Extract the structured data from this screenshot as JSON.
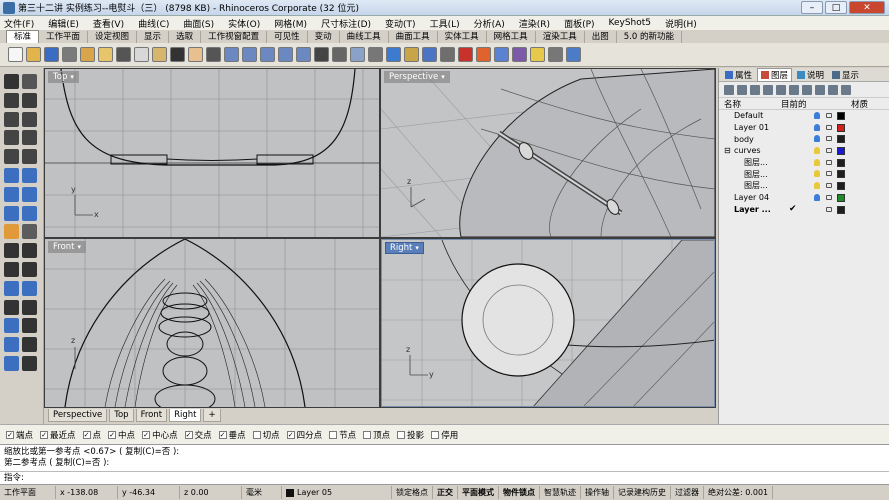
{
  "app": {
    "title": "第三十二讲 实例练习--电熨斗（三） (8798 KB) - Rhinoceros Corporate (32 位元)",
    "min": "–",
    "max": "□",
    "close": "✕"
  },
  "menu": [
    "文件(F)",
    "编辑(E)",
    "查看(V)",
    "曲线(C)",
    "曲面(S)",
    "实体(O)",
    "网格(M)",
    "尺寸标注(D)",
    "变动(T)",
    "工具(L)",
    "分析(A)",
    "渲染(R)",
    "面板(P)",
    "KeyShot5",
    "说明(H)"
  ],
  "tabs": [
    "标准",
    "工作平面",
    "设定视图",
    "显示",
    "选取",
    "工作视窗配置",
    "可见性",
    "变动",
    "曲线工具",
    "曲面工具",
    "实体工具",
    "网格工具",
    "渲染工具",
    "出图",
    "5.0 的新功能"
  ],
  "toolbar_icons": [
    {
      "name": "new-file-icon",
      "color": "#f6f6f6"
    },
    {
      "name": "open-icon",
      "color": "#e3b44c"
    },
    {
      "name": "save-icon",
      "color": "#3a6cc4"
    },
    {
      "name": "print-icon",
      "color": "#7a7a7a"
    },
    {
      "name": "import-icon",
      "color": "#d9a54a"
    },
    {
      "name": "export-icon",
      "color": "#e7c56a"
    },
    {
      "name": "cut-icon",
      "color": "#555555"
    },
    {
      "name": "copy-icon",
      "color": "#d8d8d8"
    },
    {
      "name": "paste-icon",
      "color": "#d6b66c"
    },
    {
      "name": "undo-icon",
      "color": "#333333"
    },
    {
      "name": "pan-icon",
      "color": "#e8c090"
    },
    {
      "name": "rotate-view-icon",
      "color": "#555555"
    },
    {
      "name": "zoom-icon",
      "color": "#6b88c0"
    },
    {
      "name": "zoom-window-icon",
      "color": "#6b88c0"
    },
    {
      "name": "zoom-extents-icon",
      "color": "#6b88c0"
    },
    {
      "name": "zoom-selected-icon",
      "color": "#6b88c0"
    },
    {
      "name": "zoom-all-icon",
      "color": "#6b88c0"
    },
    {
      "name": "move-icon",
      "color": "#444444"
    },
    {
      "name": "select-icon",
      "color": "#666666"
    },
    {
      "name": "cplane-icon",
      "color": "#8aa2c8"
    },
    {
      "name": "grid-icon",
      "color": "#777777"
    },
    {
      "name": "hide-icon",
      "color": "#3d7bd0"
    },
    {
      "name": "lock-icon",
      "color": "#c9a54a"
    },
    {
      "name": "layer-icon",
      "color": "#4c74c4"
    },
    {
      "name": "properties-icon",
      "color": "#6e6e6e"
    },
    {
      "name": "render-icon",
      "color": "#c8322a"
    },
    {
      "name": "color-wheel-icon",
      "color": "#e0622c"
    },
    {
      "name": "shaded-icon",
      "color": "#5a82d0"
    },
    {
      "name": "rendered-icon",
      "color": "#7d5aa8"
    },
    {
      "name": "light-icon",
      "color": "#e6c84a"
    },
    {
      "name": "options-icon",
      "color": "#777777"
    },
    {
      "name": "help-icon",
      "color": "#4b7cc8"
    }
  ],
  "left_tools": [
    {
      "name": "select-arrow-icon",
      "color": "#333333"
    },
    {
      "name": "point-icon",
      "color": "#555555"
    },
    {
      "name": "polyline-icon",
      "color": "#3c3c3c"
    },
    {
      "name": "curve-icon",
      "color": "#3c3c3c"
    },
    {
      "name": "circle-icon",
      "color": "#444444"
    },
    {
      "name": "arc-icon",
      "color": "#444444"
    },
    {
      "name": "rectangle-icon",
      "color": "#444444"
    },
    {
      "name": "polygon-icon",
      "color": "#444444"
    },
    {
      "name": "ellipse-icon",
      "color": "#444444"
    },
    {
      "name": "fillet-curve-icon",
      "color": "#444444"
    },
    {
      "name": "surface-corner-icon",
      "color": "#3c6fbf"
    },
    {
      "name": "extrude-surface-icon",
      "color": "#3c6fbf"
    },
    {
      "name": "box-solid-icon",
      "color": "#3c6fbf"
    },
    {
      "name": "extrude-solid-icon",
      "color": "#3c6fbf"
    },
    {
      "name": "sphere-icon",
      "color": "#3c6fbf"
    },
    {
      "name": "mesh-icon",
      "color": "#3c6fbf"
    },
    {
      "name": "boolean-icon",
      "color": "#e09a3a"
    },
    {
      "name": "union-icon",
      "color": "#5c5c5c"
    },
    {
      "name": "trim-icon",
      "color": "#333333"
    },
    {
      "name": "split-icon",
      "color": "#333333"
    },
    {
      "name": "join-icon",
      "color": "#333333"
    },
    {
      "name": "explode-icon",
      "color": "#333333"
    },
    {
      "name": "move-tool-icon",
      "color": "#3c6fbf"
    },
    {
      "name": "rotate-tool-icon",
      "color": "#3c6fbf"
    },
    {
      "name": "scale-icon",
      "color": "#333333"
    },
    {
      "name": "mirror-icon",
      "color": "#333333"
    },
    {
      "name": "array-icon",
      "color": "#3c6fbf"
    },
    {
      "name": "group-icon",
      "color": "#333333"
    },
    {
      "name": "dimension-icon",
      "color": "#3c6fbf"
    },
    {
      "name": "text-icon",
      "color": "#333333"
    },
    {
      "name": "analysis-icon",
      "color": "#3c6fbf"
    },
    {
      "name": "render-tool-icon",
      "color": "#333333"
    }
  ],
  "viewports": {
    "top": "Top",
    "perspective": "Perspective",
    "front": "Front",
    "right": "Right",
    "axis_x": "x",
    "axis_y": "y",
    "axis_z": "z"
  },
  "viewport_tabs": [
    "Perspective",
    "Top",
    "Front",
    "Right",
    "+"
  ],
  "panel": {
    "tabs": [
      "属性",
      "图层",
      "说明",
      "显示"
    ],
    "columns": [
      "名称",
      "目前的",
      "材质"
    ],
    "layers": [
      {
        "name": "Default",
        "indent": 0,
        "color": "#000000",
        "bulb": "#3b7dd8",
        "current": ""
      },
      {
        "name": "Layer 01",
        "indent": 0,
        "color": "#d21f1f",
        "bulb": "#3b7dd8",
        "current": ""
      },
      {
        "name": "body",
        "indent": 0,
        "color": "#1e1e1e",
        "bulb": "#3b7dd8",
        "current": ""
      },
      {
        "name": "curves",
        "indent": 0,
        "color": "#1a1ad1",
        "bulb": "#e8c93a",
        "current": "",
        "expand": "⊟"
      },
      {
        "name": "图层...",
        "indent": 1,
        "color": "#1e1e1e",
        "bulb": "#e8c93a",
        "current": ""
      },
      {
        "name": "图层...",
        "indent": 1,
        "color": "#1e1e1e",
        "bulb": "#e8c93a",
        "current": ""
      },
      {
        "name": "图层...",
        "indent": 1,
        "color": "#1e1e1e",
        "bulb": "#e8c93a",
        "current": ""
      },
      {
        "name": "Layer 04",
        "indent": 0,
        "color": "#1f8c2a",
        "bulb": "#3b7dd8",
        "current": ""
      },
      {
        "name": "Layer ...",
        "indent": 0,
        "color": "#1e1e1e",
        "bulb": "",
        "current": "✔",
        "bold": true
      }
    ]
  },
  "osnaps": [
    {
      "label": "端点",
      "checked": true
    },
    {
      "label": "最近点",
      "checked": true
    },
    {
      "label": "点",
      "checked": true
    },
    {
      "label": "中点",
      "checked": true
    },
    {
      "label": "中心点",
      "checked": true
    },
    {
      "label": "交点",
      "checked": true
    },
    {
      "label": "垂点",
      "checked": true
    },
    {
      "label": "切点",
      "checked": false
    },
    {
      "label": "四分点",
      "checked": true
    },
    {
      "label": "节点",
      "checked": false
    },
    {
      "label": "顶点",
      "checked": false
    },
    {
      "label": "投影",
      "checked": false
    },
    {
      "label": "停用",
      "checked": false
    }
  ],
  "command": {
    "history": [
      "缩放比或第一参考点 <0.67> ( 复制(C)=否 ):",
      "第二参考点 ( 复制(C)=否 ):"
    ],
    "prompt": "指令:"
  },
  "status": {
    "cplane": "工作平面",
    "x": "x -138.08",
    "y": "y -46.34",
    "z": "z 0.00",
    "unit": "毫米",
    "layer": "Layer 05",
    "layer_color": "#111111",
    "items": [
      "锁定格点",
      "正交",
      "平面模式",
      "物件锁点",
      "智慧轨迹",
      "操作轴",
      "记录建构历史",
      "过滤器",
      "绝对公差: 0.001"
    ],
    "bold": [
      "正交",
      "平面模式",
      "物件锁点"
    ]
  }
}
